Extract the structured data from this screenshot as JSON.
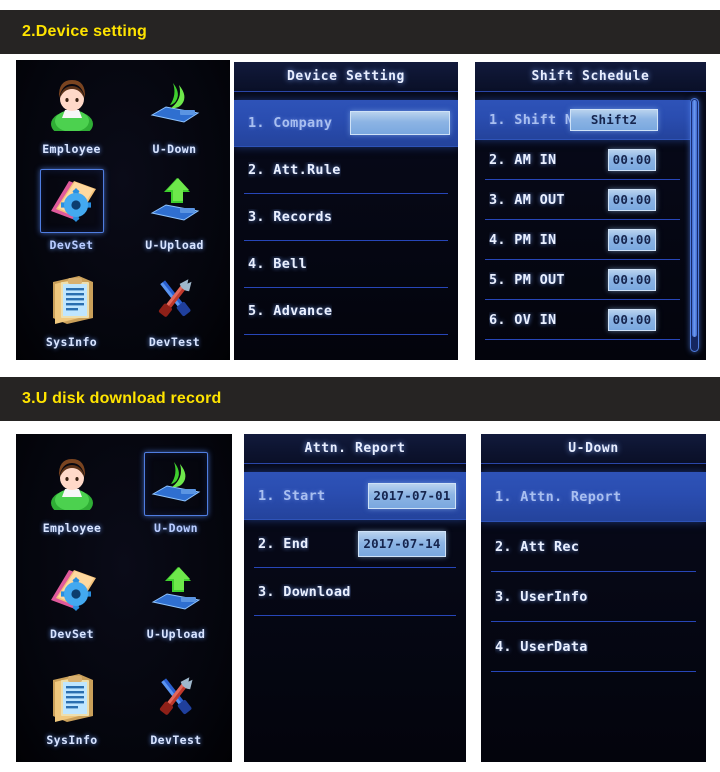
{
  "sections": [
    {
      "id": "sec2",
      "title": "2.Device setting"
    },
    {
      "id": "sec3",
      "title": "3.U disk download record"
    }
  ],
  "colors": {
    "section_bar_bg": "#262423",
    "section_title": "#ffe400",
    "screen_bg": "#05060f",
    "highlight": "#2a4db0",
    "field_bg": "#8cb4e4",
    "field_text": "#16254e",
    "menu_text": "#eaf0ff",
    "divider": "#2746b8",
    "selection_border": "#4f7de0"
  },
  "home_menu_top": {
    "selected": "DevSet",
    "items": [
      {
        "label": "Employee",
        "icon": "employee-icon",
        "selected": false
      },
      {
        "label": "U-Down",
        "icon": "u-download-icon",
        "selected": false
      },
      {
        "label": "DevSet",
        "icon": "device-setting-icon",
        "selected": true
      },
      {
        "label": "U-Upload",
        "icon": "u-upload-icon",
        "selected": false
      },
      {
        "label": "SysInfo",
        "icon": "system-info-icon",
        "selected": false
      },
      {
        "label": "DevTest",
        "icon": "device-test-icon",
        "selected": false
      }
    ]
  },
  "home_menu_bottom": {
    "selected": "U-Down",
    "items": [
      {
        "label": "Employee",
        "icon": "employee-icon",
        "selected": false
      },
      {
        "label": "U-Down",
        "icon": "u-download-icon",
        "selected": true
      },
      {
        "label": "DevSet",
        "icon": "device-setting-icon",
        "selected": false
      },
      {
        "label": "U-Upload",
        "icon": "u-upload-icon",
        "selected": false
      },
      {
        "label": "SysInfo",
        "icon": "system-info-icon",
        "selected": false
      },
      {
        "label": "DevTest",
        "icon": "device-test-icon",
        "selected": false
      }
    ]
  },
  "device_setting": {
    "title": "Device Setting",
    "rows": [
      {
        "text": "1. Company",
        "selected": true,
        "field": ""
      },
      {
        "text": "2. Att.Rule",
        "selected": false,
        "field": null
      },
      {
        "text": "3. Records",
        "selected": false,
        "field": null
      },
      {
        "text": "4. Bell",
        "selected": false,
        "field": null
      },
      {
        "text": "5. Advance",
        "selected": false,
        "field": null
      }
    ]
  },
  "shift_schedule": {
    "title": "Shift Schedule",
    "has_scrollbar": true,
    "rows": [
      {
        "text": "1. Shift Nam",
        "selected": true,
        "field": "Shift2"
      },
      {
        "text": "2. AM IN",
        "selected": false,
        "field": "00:00"
      },
      {
        "text": "3. AM OUT",
        "selected": false,
        "field": "00:00"
      },
      {
        "text": "4. PM IN",
        "selected": false,
        "field": "00:00"
      },
      {
        "text": "5. PM OUT",
        "selected": false,
        "field": "00:00"
      },
      {
        "text": "6. OV IN",
        "selected": false,
        "field": "00:00"
      }
    ]
  },
  "attn_report": {
    "title": "Attn. Report",
    "rows": [
      {
        "text": "1. Start",
        "selected": true,
        "field": "2017-07-01"
      },
      {
        "text": "2. End",
        "selected": false,
        "field": "2017-07-14"
      },
      {
        "text": "3. Download",
        "selected": false,
        "field": null
      }
    ]
  },
  "u_down": {
    "title": "U-Down",
    "rows": [
      {
        "text": "1. Attn. Report",
        "selected": true,
        "field": null
      },
      {
        "text": "2. Att Rec",
        "selected": false,
        "field": null
      },
      {
        "text": "3. UserInfo",
        "selected": false,
        "field": null
      },
      {
        "text": "4. UserData",
        "selected": false,
        "field": null
      }
    ]
  }
}
